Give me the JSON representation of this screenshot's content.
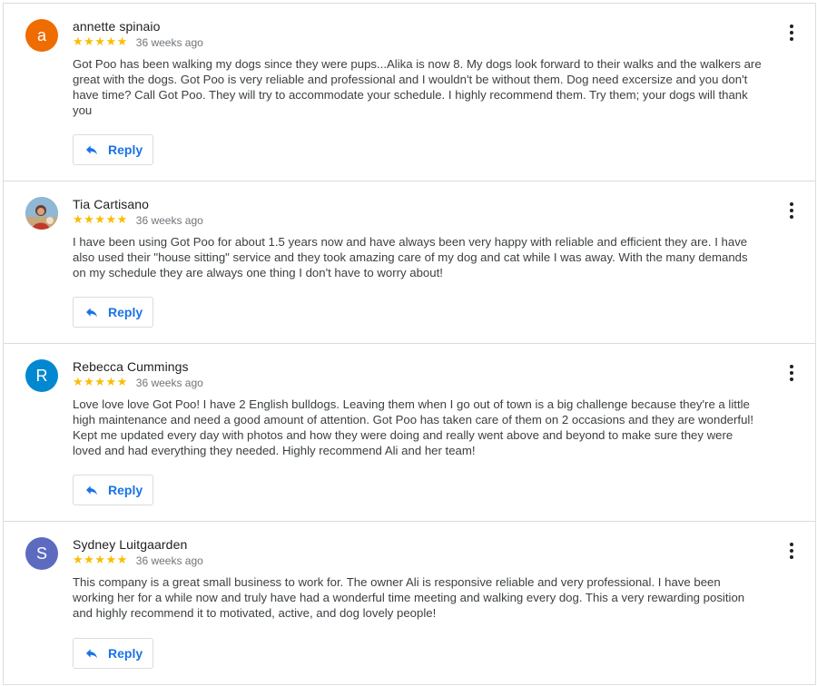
{
  "reviews": [
    {
      "avatar_letter": "a",
      "avatar_color": "#ef6c00",
      "name": "annette spinaio",
      "stars": "★★★★★",
      "rating": 5,
      "date": "36 weeks ago",
      "text": "Got Poo has been walking my dogs since they were pups...Alika is now 8. My dogs look forward to their walks and the walkers are great with the dogs. Got Poo is very reliable and professional and I wouldn't be without them. Dog need excersize and you don't have time? Call Got Poo. They will try to accommodate your schedule. I highly recommend them. Try them; your dogs will thank you",
      "reply_label": "Reply"
    },
    {
      "avatar_letter": "",
      "avatar_color": "#7aa5c4",
      "name": "Tia Cartisano",
      "stars": "★★★★★",
      "rating": 5,
      "date": "36 weeks ago",
      "text": "I have been using Got Poo for about 1.5 years now and have always been very happy with reliable and efficient they are. I have also used their \"house sitting\" service and they took amazing care of my dog and cat while I was away. With the many demands on my schedule they are always one thing I don't have to worry about!",
      "reply_label": "Reply"
    },
    {
      "avatar_letter": "R",
      "avatar_color": "#0288d1",
      "name": "Rebecca Cummings",
      "stars": "★★★★★",
      "rating": 5,
      "date": "36 weeks ago",
      "text": "Love love love Got Poo! I have 2 English bulldogs. Leaving them when I go out of town is a big challenge because they're a little high maintenance and need a good amount of attention. Got Poo has taken care of them on 2 occasions and they are wonderful! Kept me updated every day with photos and how they were doing and really went above and beyond to make sure they were loved and had everything they needed. Highly recommend Ali and her team!",
      "reply_label": "Reply"
    },
    {
      "avatar_letter": "S",
      "avatar_color": "#5c6bc0",
      "name": "Sydney Luitgaarden",
      "stars": "★★★★★",
      "rating": 5,
      "date": "36 weeks ago",
      "text": "This company is a great small business to work for. The owner Ali is responsive reliable and very professional. I have been working her for a while now and truly have had a wonderful time meeting and walking every dog. This a very rewarding position and highly recommend it to motivated, active, and dog lovely people!",
      "reply_label": "Reply"
    }
  ]
}
